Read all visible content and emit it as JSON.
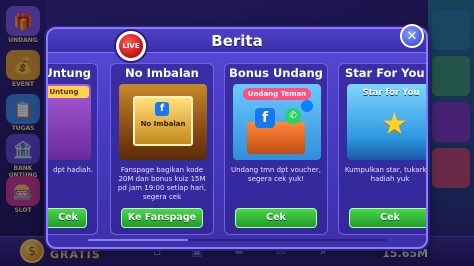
{
  "lobby": {
    "left_items": [
      {
        "label": "UNDANG"
      },
      {
        "label": "EVENT"
      },
      {
        "label": "TUGAS"
      },
      {
        "label": "BANK UNTUNG"
      },
      {
        "label": "SLOT"
      }
    ],
    "bottom": {
      "gratis_label": "GRATIS",
      "balance": "15.65M"
    }
  },
  "dialog": {
    "title": "Berita",
    "live_label": "LIVE",
    "close_label": "✕",
    "cards": [
      {
        "title": "Untung",
        "image_label": "Untung",
        "description": "dpt hadiah.",
        "button_label": "Cek"
      },
      {
        "title": "No Imbalan",
        "image_label": "No Imbalan",
        "description": "Fanspage bagikan kode 20M dan bonus kuiz 15M pd jam 19:00 setiap hari, segera cek",
        "button_label": "Ke Fanspage"
      },
      {
        "title": "Bonus Undang",
        "image_label": "Undang Teman",
        "description": "Undang tmn dpt voucher, segera cek yuk!",
        "button_label": "Cek"
      },
      {
        "title": "Star For You",
        "image_label": "Star for You",
        "description": "Kumpulkan star, tukarkan hadiah yuk",
        "button_label": "Cek"
      }
    ]
  },
  "colors": {
    "dialog_bg": "#4a3cc4",
    "button_green": "#2fbf35",
    "live_red": "#d81a1a",
    "close_blue": "#5a6ae0"
  }
}
